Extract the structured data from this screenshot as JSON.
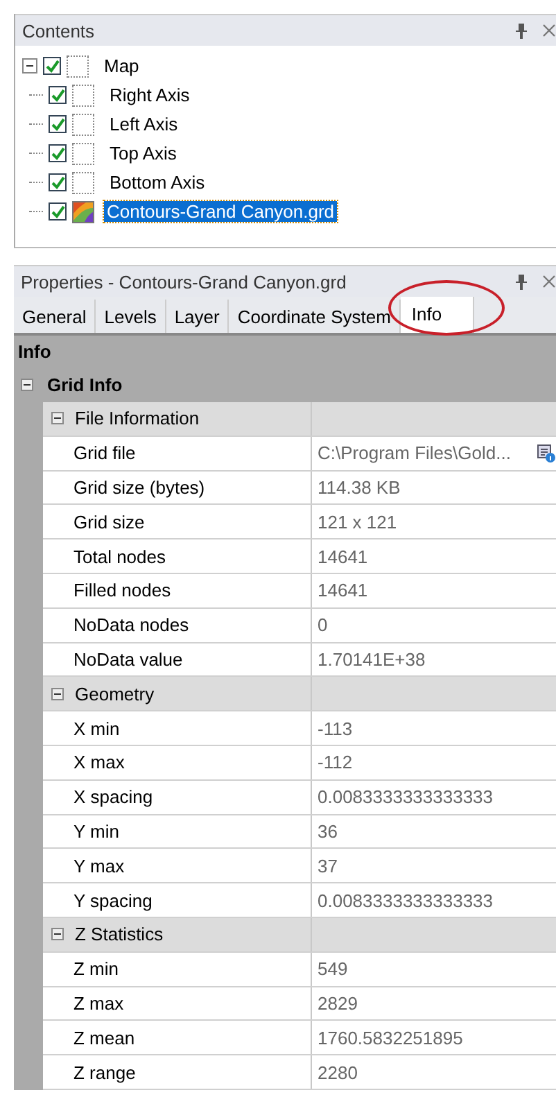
{
  "contents": {
    "title": "Contents",
    "tree": {
      "label": "Map",
      "kind": "map",
      "expanded": true,
      "checked": true,
      "selected": false,
      "children": [
        {
          "label": "Right Axis",
          "kind": "axis",
          "checked": true,
          "selected": false
        },
        {
          "label": "Left Axis",
          "kind": "axis",
          "checked": true,
          "selected": false
        },
        {
          "label": "Top Axis",
          "kind": "axis",
          "checked": true,
          "selected": false
        },
        {
          "label": "Bottom Axis",
          "kind": "axis",
          "checked": true,
          "selected": false
        },
        {
          "label": "Contours-Grand Canyon.grd",
          "kind": "contour",
          "checked": true,
          "selected": true
        }
      ]
    }
  },
  "properties": {
    "title": "Properties - Contours-Grand Canyon.grd",
    "tabs": [
      {
        "label": "General",
        "selected": false
      },
      {
        "label": "Levels",
        "selected": false
      },
      {
        "label": "Layer",
        "selected": false
      },
      {
        "label": "Coordinate System",
        "selected": false
      },
      {
        "label": "Info",
        "selected": true,
        "circled": true
      }
    ],
    "heading": "Info",
    "group": {
      "label": "Grid Info",
      "expanded": true,
      "sections": [
        {
          "title": "File Information",
          "expanded": true,
          "rows": [
            {
              "name": "Grid file",
              "value": "C:\\Program Files\\Gold...",
              "browse": true
            },
            {
              "name": "Grid size (bytes)",
              "value": "114.38 KB"
            },
            {
              "name": "Grid size",
              "value": "121 x 121"
            },
            {
              "name": "Total nodes",
              "value": "14641"
            },
            {
              "name": "Filled nodes",
              "value": "14641"
            },
            {
              "name": "NoData nodes",
              "value": "0"
            },
            {
              "name": "NoData value",
              "value": "1.70141E+38"
            }
          ]
        },
        {
          "title": "Geometry",
          "expanded": true,
          "rows": [
            {
              "name": "X min",
              "value": "-113"
            },
            {
              "name": "X max",
              "value": "-112"
            },
            {
              "name": "X spacing",
              "value": "0.0083333333333333"
            },
            {
              "name": "Y min",
              "value": "36"
            },
            {
              "name": "Y max",
              "value": "37"
            },
            {
              "name": "Y spacing",
              "value": "0.0083333333333333"
            }
          ]
        },
        {
          "title": "Z Statistics",
          "expanded": true,
          "rows": [
            {
              "name": "Z min",
              "value": "549"
            },
            {
              "name": "Z max",
              "value": "2829"
            },
            {
              "name": "Z mean",
              "value": "1760.5832251895"
            },
            {
              "name": "Z range",
              "value": "2280"
            }
          ]
        }
      ]
    }
  }
}
